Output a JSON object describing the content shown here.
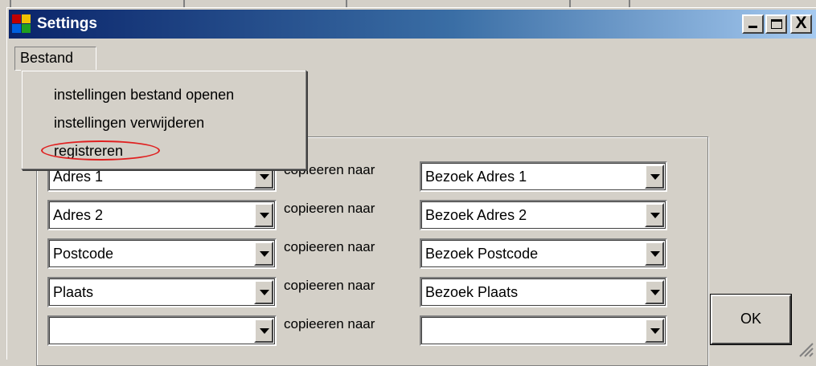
{
  "window": {
    "title": "Settings",
    "controls": [
      "minimize",
      "maximize",
      "close"
    ],
    "close_glyph": "X"
  },
  "menubar": {
    "items": [
      {
        "label": "Bestand"
      }
    ]
  },
  "bestand_menu": {
    "items": [
      {
        "label": "instellingen bestand openen"
      },
      {
        "label": "instellingen verwijderen"
      },
      {
        "label": "registreren",
        "highlighted": true,
        "highlight_color": "#e02020"
      }
    ]
  },
  "mappings": {
    "copy_label": "copieeren naar",
    "rows": [
      {
        "source": "Adres 1",
        "target": "Bezoek Adres 1"
      },
      {
        "source": "Adres 2",
        "target": "Bezoek Adres 2"
      },
      {
        "source": "Postcode",
        "target": "Bezoek Postcode"
      },
      {
        "source": "Plaats",
        "target": "Bezoek Plaats"
      },
      {
        "source": "",
        "target": ""
      }
    ]
  },
  "buttons": {
    "ok_label": "OK"
  },
  "colors": {
    "face": "#d4d0c8",
    "title_start": "#0a246a",
    "title_end": "#a6caf0"
  }
}
